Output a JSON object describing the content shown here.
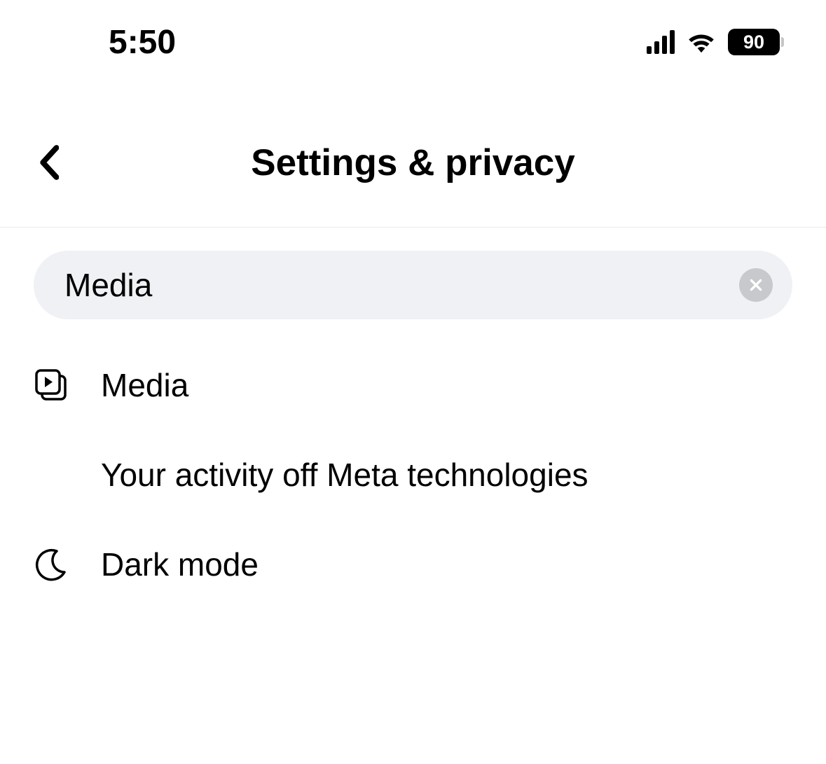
{
  "status": {
    "time": "5:50",
    "battery": "90"
  },
  "header": {
    "title": "Settings & privacy"
  },
  "search": {
    "value": "Media"
  },
  "results": [
    {
      "icon": "media-icon",
      "label": "Media"
    },
    {
      "icon": "",
      "label": "Your activity off Meta technologies"
    },
    {
      "icon": "moon-icon",
      "label": "Dark mode"
    }
  ]
}
